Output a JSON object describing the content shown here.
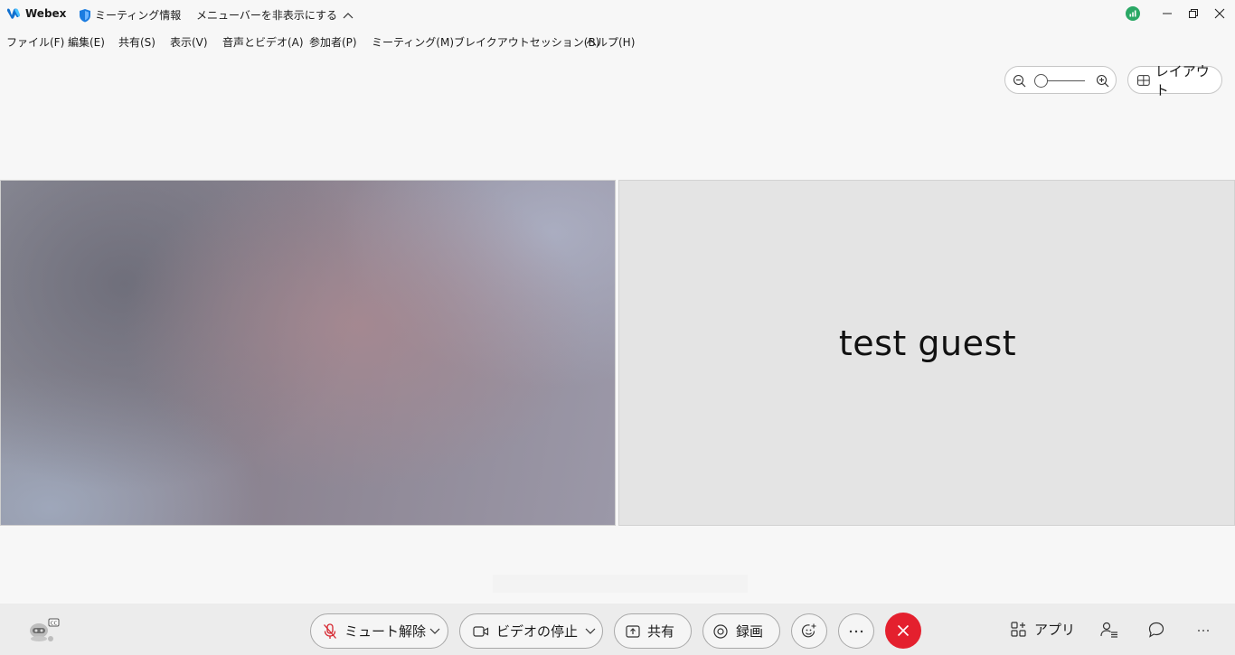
{
  "titlebar": {
    "app_name": "Webex",
    "meeting_info": "ミーティング情報",
    "hide_menubar": "メニューバーを非表示にする"
  },
  "menubar": {
    "items": [
      {
        "label": "ファイル(F)"
      },
      {
        "label": "編集(E)"
      },
      {
        "label": "共有(S)"
      },
      {
        "label": "表示(V)"
      },
      {
        "label": "音声とビデオ(A)"
      },
      {
        "label": "参加者(P)"
      },
      {
        "label": "ミーティング(M)"
      },
      {
        "label": "ブレイクアウトセッション(B)"
      },
      {
        "label": "ヘルプ(H)"
      }
    ]
  },
  "view": {
    "layout_label": "レイアウト"
  },
  "participants": [
    {
      "name": ""
    },
    {
      "name": "test guest"
    }
  ],
  "controls": {
    "unmute_label": "ミュート解除",
    "stop_video_label": "ビデオの停止",
    "share_label": "共有",
    "record_label": "録画",
    "apps_label": "アプリ"
  },
  "colors": {
    "leave_button": "#e4202e",
    "status_green": "#2aa865"
  }
}
